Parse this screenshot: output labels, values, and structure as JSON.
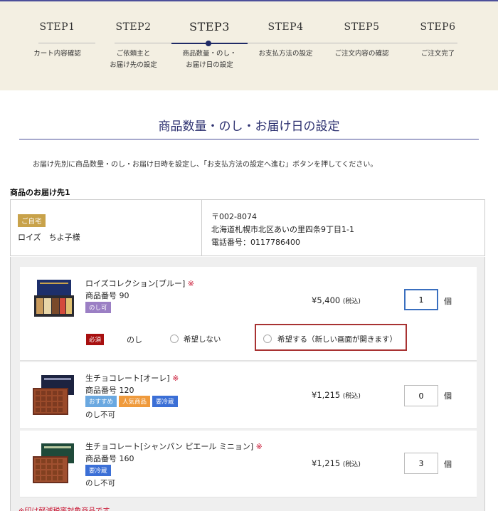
{
  "steps": [
    {
      "title": "STEP1",
      "label": "カート内容確認"
    },
    {
      "title": "STEP2",
      "label": "ご依頼主と\nお届け先の設定"
    },
    {
      "title": "STEP3",
      "label": "商品数量・のし・\nお届け日の設定"
    },
    {
      "title": "STEP4",
      "label": "お支払方法の設定"
    },
    {
      "title": "STEP5",
      "label": "ご注文内容の確認"
    },
    {
      "title": "STEP6",
      "label": "ご注文完了"
    }
  ],
  "active_step": 3,
  "page": {
    "title": "商品数量・のし・お届け日の設定",
    "instruction": "お届け先別に商品数量・のし・お届け日時を設定し、「お支払方法の設定へ進む」ボタンを押してください。",
    "section_label": "商品のお届け先1"
  },
  "recipient": {
    "badge": "ご自宅",
    "name": "ロイズ　ちよ子様",
    "postal": "〒002-8074",
    "address": "北海道札幌市北区あいの里四条9丁目1-1",
    "phone": "電話番号：0117786400"
  },
  "products": [
    {
      "name": "ロイズコレクション[ブルー]",
      "tax_mark": "※",
      "code": "商品番号 90",
      "tags": [
        {
          "text": "のし可",
          "color": "#9b7fc4"
        }
      ],
      "price": "¥5,400",
      "tax_label": "(税込)",
      "quantity": "1",
      "unit": "個"
    },
    {
      "name": "生チョコレート[オーレ]",
      "tax_mark": "※",
      "code": "商品番号 120",
      "tags": [
        {
          "text": "おすすめ",
          "color": "#6aa8e0"
        },
        {
          "text": "人気商品",
          "color": "#ef9a3c"
        },
        {
          "text": "要冷蔵",
          "color": "#3b6fd6"
        }
      ],
      "noshi_status": "のし不可",
      "price": "¥1,215",
      "tax_label": "(税込)",
      "quantity": "0",
      "unit": "個"
    },
    {
      "name": "生チョコレート[シャンパン ピエール ミニョン]",
      "tax_mark": "※",
      "code": "商品番号 160",
      "tags": [
        {
          "text": "要冷蔵",
          "color": "#3b6fd6"
        }
      ],
      "noshi_status": "のし不可",
      "price": "¥1,215",
      "tax_label": "(税込)",
      "quantity": "3",
      "unit": "個"
    }
  ],
  "noshi": {
    "required_badge": "必須",
    "label": "のし",
    "option_no": "希望しない",
    "option_yes": "希望する（新しい画面が開きます）"
  },
  "footnote": "※印は軽減税率対象商品です。",
  "colors": {
    "accent_navy": "#2d3170",
    "step_bar_bg": "#f3efe2",
    "required_red": "#a81010",
    "highlight_red": "#a83232",
    "home_badge_gold": "#c8a24a"
  }
}
